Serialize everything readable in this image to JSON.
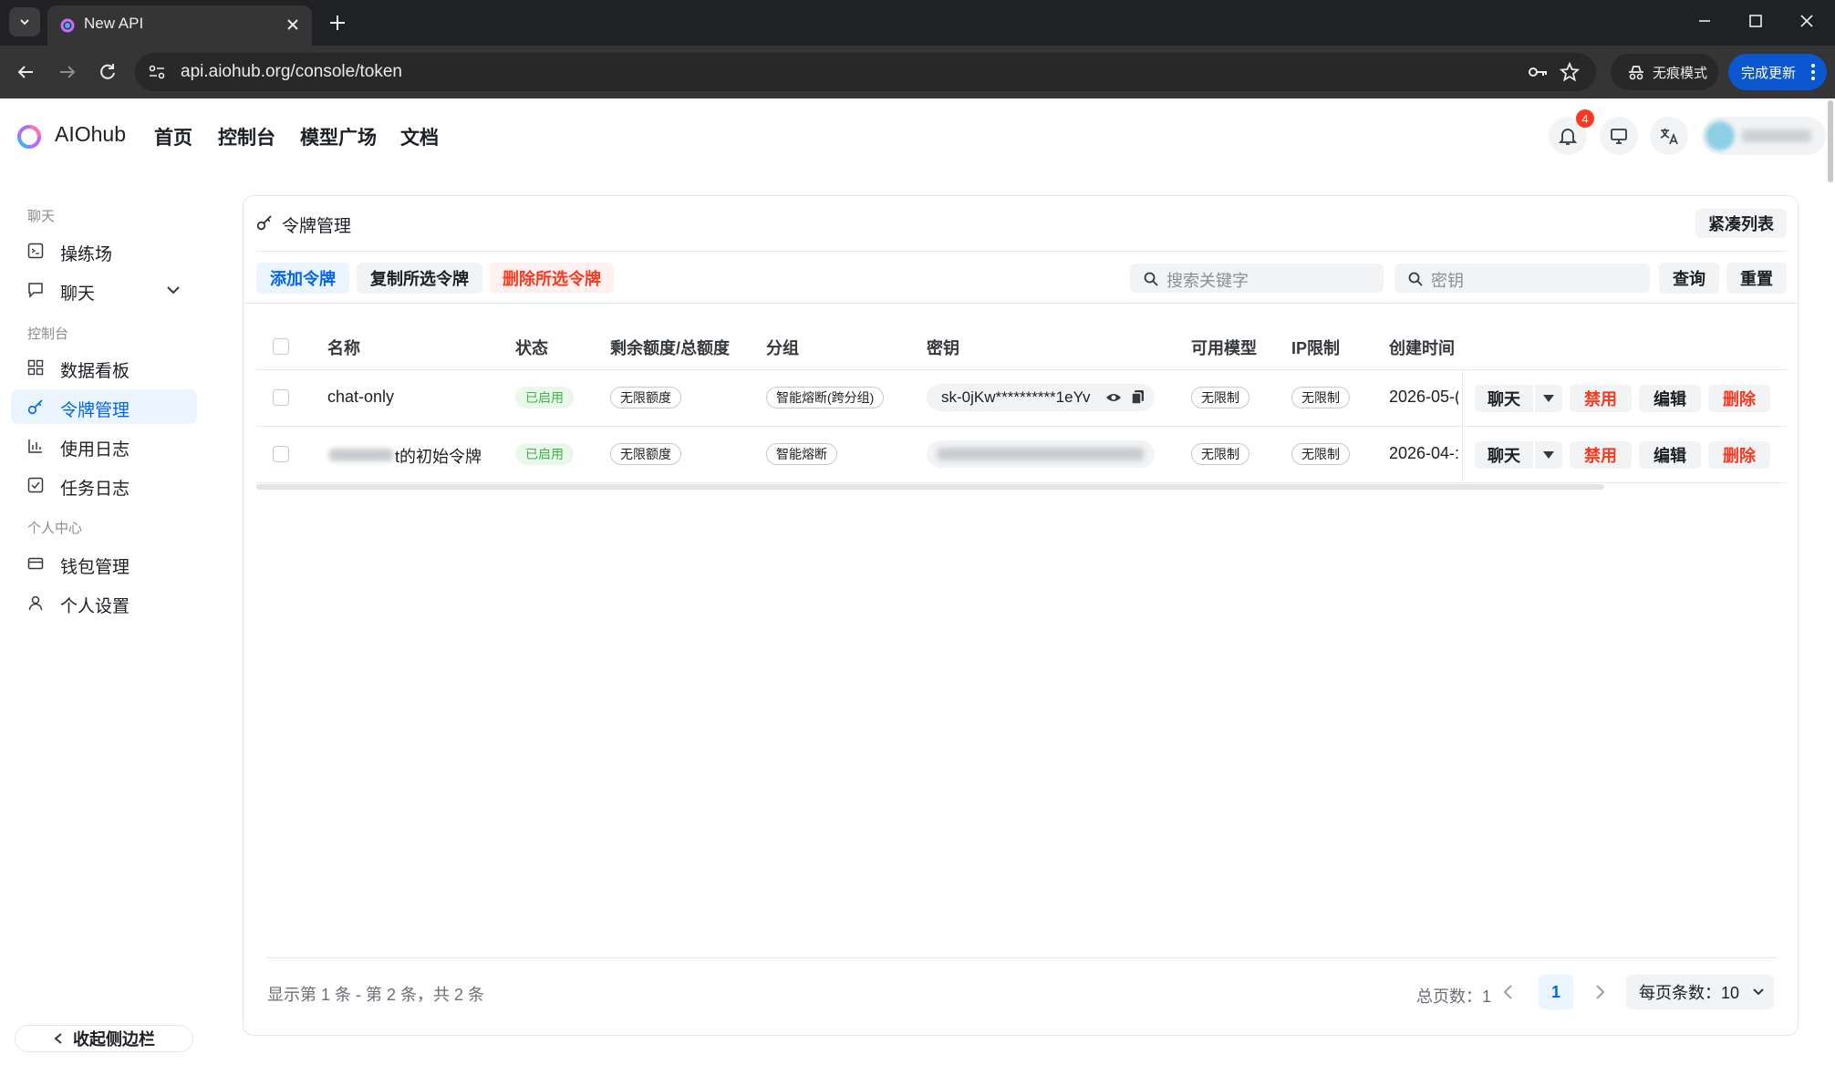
{
  "browser": {
    "tab_title": "New API",
    "url": "api.aiohub.org/console/token",
    "incognito_label": "无痕模式",
    "update_label": "完成更新"
  },
  "header": {
    "brand": "AIOhub",
    "nav": [
      "首页",
      "控制台",
      "模型广场",
      "文档"
    ],
    "notification_count": "4"
  },
  "sidebar": {
    "sections": [
      {
        "title": "聊天",
        "items": [
          {
            "label": "操练场",
            "icon": "playground-icon"
          },
          {
            "label": "聊天",
            "icon": "chat-icon"
          }
        ]
      },
      {
        "title": "控制台",
        "items": [
          {
            "label": "数据看板",
            "icon": "dashboard-icon"
          },
          {
            "label": "令牌管理",
            "icon": "key-icon",
            "active": true
          },
          {
            "label": "使用日志",
            "icon": "chart-icon"
          },
          {
            "label": "任务日志",
            "icon": "task-icon"
          }
        ]
      },
      {
        "title": "个人中心",
        "items": [
          {
            "label": "钱包管理",
            "icon": "wallet-icon"
          },
          {
            "label": "个人设置",
            "icon": "user-icon"
          }
        ]
      }
    ],
    "collapse_label": "收起侧边栏"
  },
  "card": {
    "title": "令牌管理",
    "compact_label": "紧凑列表",
    "actions": {
      "add": "添加令牌",
      "copy": "复制所选令牌",
      "delete": "删除所选令牌"
    },
    "search": {
      "keyword_placeholder": "搜索关键字",
      "key_placeholder": "密钥",
      "query": "查询",
      "reset": "重置"
    }
  },
  "table": {
    "columns": [
      "名称",
      "状态",
      "剩余额度/总额度",
      "分组",
      "密钥",
      "可用模型",
      "IP限制",
      "创建时间"
    ],
    "rows": [
      {
        "name": "chat-only",
        "status": "已启用",
        "quota": "无限额度",
        "group": "智能熔断(跨分组)",
        "key": "sk-0jKw**********1eYv",
        "models": "无限制",
        "ip": "无限制",
        "created": "2026-05-("
      },
      {
        "name_suffix": "t的初始令牌",
        "status": "已启用",
        "quota": "无限额度",
        "group": "智能熔断",
        "key": "",
        "models": "无限制",
        "ip": "无限制",
        "created": "2026-04-:"
      }
    ],
    "row_actions": {
      "chat": "聊天",
      "disable": "禁用",
      "edit": "编辑",
      "delete": "删除"
    }
  },
  "footer": {
    "info": "显示第 1 条 - 第 2 条，共 2 条",
    "total_pages": "总页数：1",
    "current_page": "1",
    "page_size": "每页条数：10"
  }
}
